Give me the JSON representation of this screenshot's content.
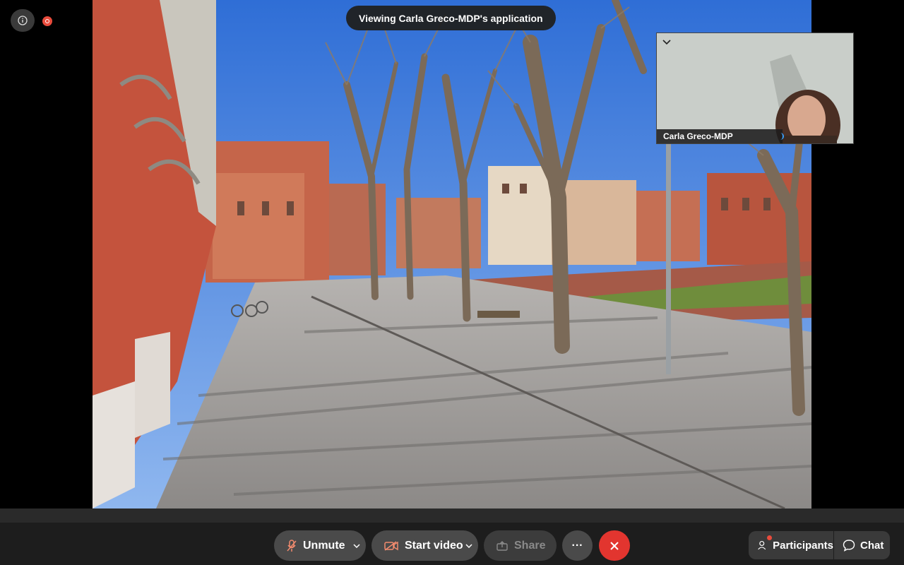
{
  "banner": {
    "text": "Viewing Carla Greco-MDP's application"
  },
  "selfview": {
    "name": "Carla Greco-MDP"
  },
  "controls": {
    "unmute_label": "Unmute",
    "video_label": "Start video",
    "share_label": "Share",
    "more_label": "···",
    "participants_label": "Participants",
    "chat_label": "Chat"
  },
  "icons": {
    "info": "info-icon",
    "record": "record-icon",
    "mic_muted": "mic-muted-icon",
    "video_off": "video-off-icon",
    "share": "share-icon",
    "more": "more-icon",
    "leave": "close-icon",
    "participants": "participants-icon",
    "chat": "chat-icon",
    "collapse": "chevron-down-icon"
  },
  "colors": {
    "leave": "#e2352f",
    "record": "#e84b3c",
    "muted_accent": "#f28b6e"
  }
}
